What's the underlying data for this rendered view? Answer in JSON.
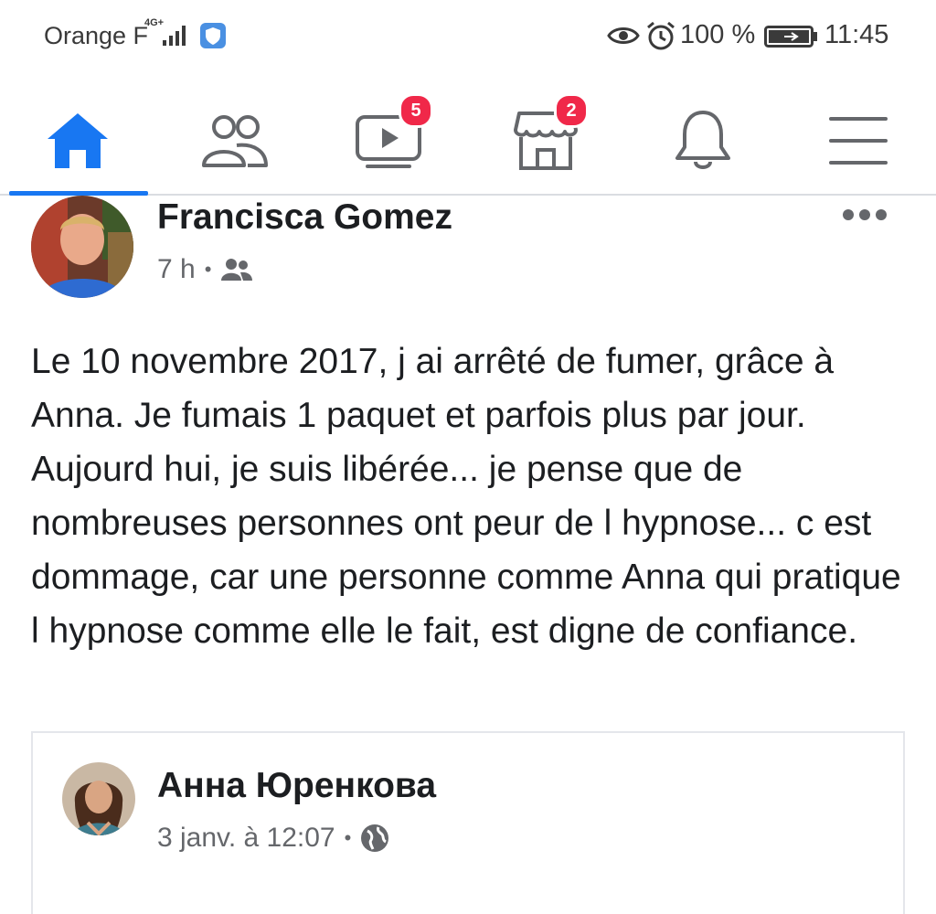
{
  "status_bar": {
    "carrier": "Orange F",
    "network_type": "4G+",
    "battery_percent": "100 %",
    "time": "11:45"
  },
  "nav": {
    "watch_badge": "5",
    "marketplace_badge": "2",
    "active_tab": "home",
    "accent_color": "#1877f2",
    "badge_color": "#f02849"
  },
  "post": {
    "author": "Francisca Gomez",
    "time": "7 h",
    "separator": "•",
    "audience_icon": "friends-icon",
    "text": "Le 10 novembre 2017, j ai arrêté de fumer, grâce à Anna. Je fumais 1 paquet et parfois plus par jour.  Aujourd hui, je suis libérée... je pense que de nombreuses personnes ont peur de l hypnose... c est dommage, car une personne comme Anna qui pratique l hypnose comme elle le fait, est digne de confiance."
  },
  "shared_post": {
    "author": "Анна Юренкова",
    "time": "3 janv. à 12:07",
    "separator": "•",
    "audience_icon": "globe-icon"
  }
}
